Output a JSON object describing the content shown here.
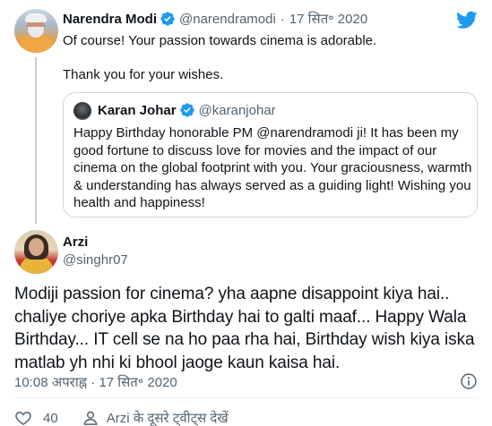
{
  "parent_tweet": {
    "name": "Narendra Modi",
    "handle": "@narendramodi",
    "separator": "·",
    "date": "17 सित॰ 2020",
    "text_line1": "Of course! Your passion towards cinema is adorable.",
    "text_line2": "Thank you for your wishes."
  },
  "quoted_tweet": {
    "name": "Karan Johar",
    "handle": "@karanjohar",
    "text": "Happy Birthday honorable PM @narendramodi ji! It has been my good fortune to discuss love for movies and the impact of our cinema on the global footprint with you. Your graciousness, warmth & understanding has always served as a guiding light! Wishing you health and happiness!"
  },
  "reply_tweet": {
    "name": "Arzi",
    "handle": "@singhr07",
    "text": "Modiji passion for cinema? yha aapne disappoint kiya hai.. chaliye choriye apka Birthday hai to galti maaf... Happy Wala Birthday... IT cell se na ho paa rha hai, Birthday wish kiya iska matlab yh nhi ki bhool jaoge kaun kaisa hai.",
    "timestamp": "10:08 अपराह्न · 17 सित॰ 2020",
    "like_count": "40",
    "more_tweets_link": "Arzi के दूसरे ट्वीट्स देखें"
  },
  "icons": {
    "brand": "twitter-bird-icon",
    "verified": "verified-badge-icon",
    "info": "info-icon",
    "like": "heart-icon",
    "person": "person-icon"
  },
  "colors": {
    "twitter_blue": "#1d9bf0",
    "text_primary": "#0f1419",
    "text_secondary": "#536471",
    "border": "#cfd9de",
    "thread_line": "#c4cfd6"
  }
}
